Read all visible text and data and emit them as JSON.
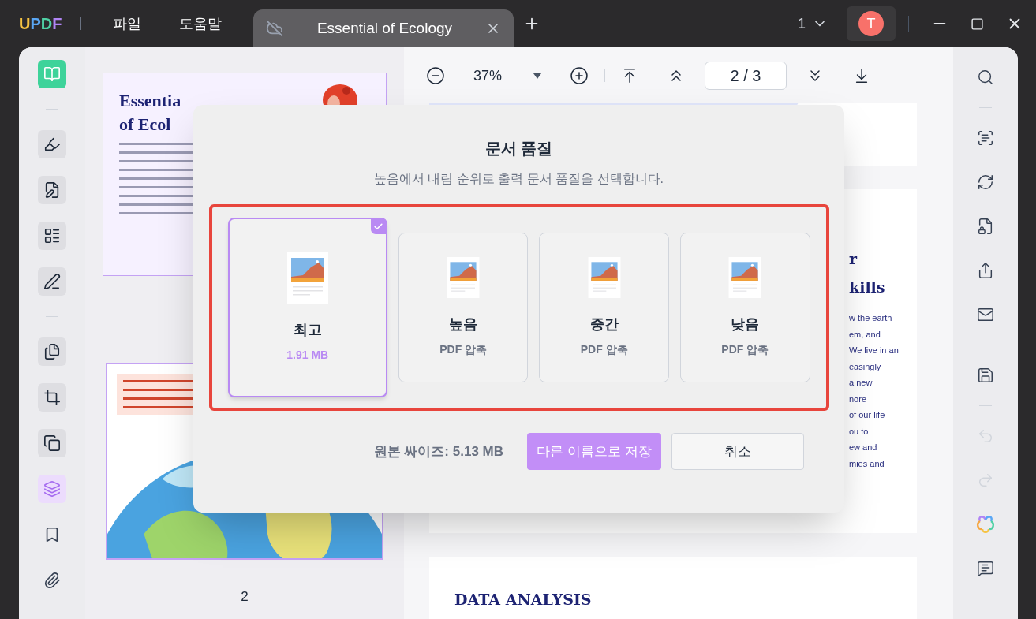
{
  "titlebar": {
    "logo": [
      {
        "letter": "U",
        "color": "#f6c342"
      },
      {
        "letter": "P",
        "color": "#5aa7f5"
      },
      {
        "letter": "D",
        "color": "#4fd1a5"
      },
      {
        "letter": "F",
        "color": "#b084f5"
      }
    ],
    "menus": [
      "파일",
      "도움말"
    ],
    "tab": {
      "title": "Essential of Ecology",
      "selected": true
    },
    "window_count": "1",
    "avatar": "T"
  },
  "left_tools": [
    {
      "kind": "reader",
      "selected": true
    },
    {
      "kind": "divider"
    },
    {
      "kind": "highlight",
      "selected": false
    },
    {
      "kind": "edit",
      "selected": false
    },
    {
      "kind": "form",
      "selected": false
    },
    {
      "kind": "sign",
      "selected": false
    },
    {
      "kind": "divider"
    },
    {
      "kind": "organize",
      "selected": false
    },
    {
      "kind": "crop",
      "selected": false
    },
    {
      "kind": "copy",
      "selected": false
    },
    {
      "kind": "layers",
      "selected": true
    },
    {
      "kind": "bookmark",
      "selected": false
    },
    {
      "kind": "attachment",
      "selected": false
    }
  ],
  "thumbnails": {
    "cover_title": [
      "Essentia",
      "of Ecol"
    ],
    "page_label": "2"
  },
  "toolbar": {
    "zoom": "37%",
    "page": "2 / 3"
  },
  "document": {
    "heading_fragments": [
      "r",
      "kills"
    ],
    "body_fragments": [
      "w the earth",
      "em, and",
      "We live in an",
      "easingly",
      "a new",
      "nore",
      "of our life-",
      "ou to",
      "ew and",
      "mies and"
    ],
    "next_heading": "DATA ANALYSIS"
  },
  "dialog": {
    "title": "문서 품질",
    "subtitle": "높음에서 내림 순위로 출력 문서 품질을 선택합니다.",
    "options": [
      {
        "label": "최고",
        "detail": "1.91 MB",
        "selected": true
      },
      {
        "label": "높음",
        "detail": "PDF 압축",
        "selected": false
      },
      {
        "label": "중간",
        "detail": "PDF 압축",
        "selected": false
      },
      {
        "label": "낮음",
        "detail": "PDF 압축",
        "selected": false
      }
    ],
    "original_size": "원본 싸이즈: 5.13 MB",
    "save_button": "다른 이름으로 저장",
    "cancel_button": "취소"
  },
  "right_tools": [
    {
      "kind": "search",
      "disabled": false
    },
    {
      "kind": "divider"
    },
    {
      "kind": "ocr",
      "disabled": false
    },
    {
      "kind": "convert",
      "disabled": false
    },
    {
      "kind": "protect",
      "disabled": false
    },
    {
      "kind": "share",
      "disabled": false
    },
    {
      "kind": "mail",
      "disabled": false
    },
    {
      "kind": "divider"
    },
    {
      "kind": "save",
      "disabled": false
    },
    {
      "kind": "divider"
    },
    {
      "kind": "undo",
      "disabled": true
    },
    {
      "kind": "redo",
      "disabled": true
    },
    {
      "kind": "ai"
    },
    {
      "kind": "comment",
      "disabled": false
    }
  ]
}
